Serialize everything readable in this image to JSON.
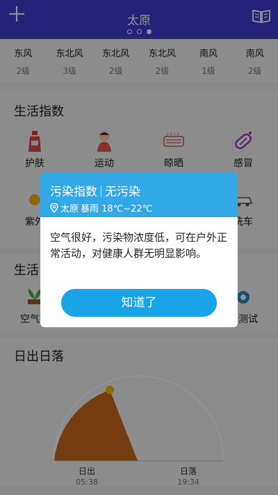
{
  "header": {
    "city": "太原",
    "page_dots": 3,
    "active_dot": 2
  },
  "wind": [
    {
      "dir": "东风",
      "level": "2级"
    },
    {
      "dir": "东北风",
      "level": "3级"
    },
    {
      "dir": "东北风",
      "level": "2级"
    },
    {
      "dir": "东北风",
      "level": "2级"
    },
    {
      "dir": "南风",
      "level": "1级"
    },
    {
      "dir": "南风",
      "level": "2级"
    }
  ],
  "life": {
    "title": "生活指数",
    "row1": [
      "护肤",
      "运动",
      "晾晒",
      "感冒"
    ],
    "row2_left": "紫外",
    "row2_right": "洗车"
  },
  "life2": {
    "title_partial": "生活",
    "left_label": "空气指",
    "right_label": "业测试"
  },
  "sun": {
    "title": "日出日落",
    "sunrise_label": "日出",
    "sunrise_time": "05:38",
    "sunset_label": "日落",
    "sunset_time": "19:34"
  },
  "dialog": {
    "title": "污染指数",
    "status": "无污染",
    "location": "太原",
    "weather": "暴雨 18℃~22℃",
    "message": "空气很好，污染物浓度低，可在户外正常活动，对健康人群无明显影响。",
    "button": "知道了"
  },
  "colors": {
    "topbar": "#3f3bd0",
    "dialog_header": "#33a8e6",
    "button": "#1aa4e8",
    "sun_fill": "#c86a1e",
    "sun_dot": "#f0b400"
  }
}
